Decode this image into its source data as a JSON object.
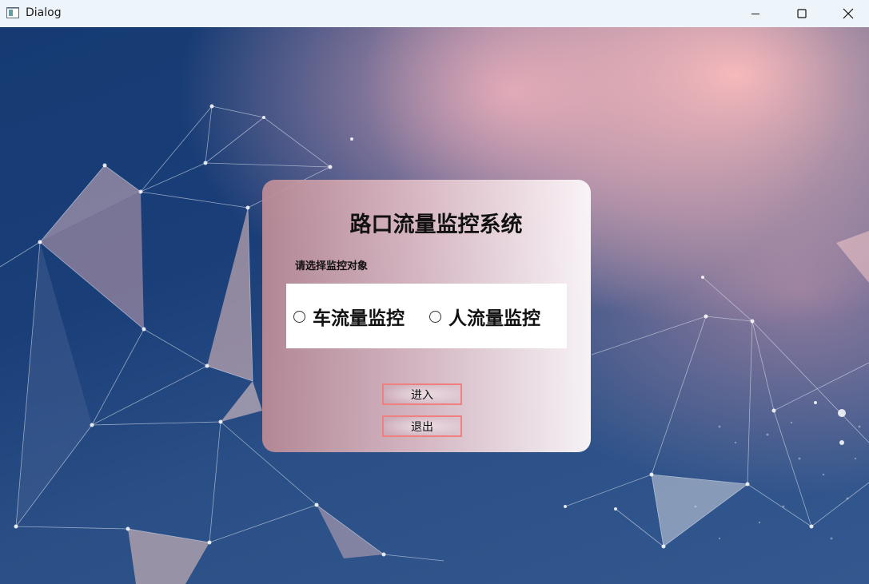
{
  "window": {
    "title": "Dialog",
    "icons": {
      "app": "app-window-icon",
      "minimize": "minimize-icon",
      "maximize": "maximize-icon",
      "close": "close-icon"
    }
  },
  "card": {
    "title": "路口流量监控系统",
    "prompt": "请选择监控对象",
    "options": [
      {
        "label": "车流量监控",
        "selected": false
      },
      {
        "label": "人流量监控",
        "selected": false
      }
    ],
    "enter_label": "进入",
    "exit_label": "退出"
  },
  "colors": {
    "titlebar_bg": "#eef5fa",
    "button_border": "#f08080",
    "background_dark": "#163b73",
    "background_pink": "#ffbebe"
  }
}
